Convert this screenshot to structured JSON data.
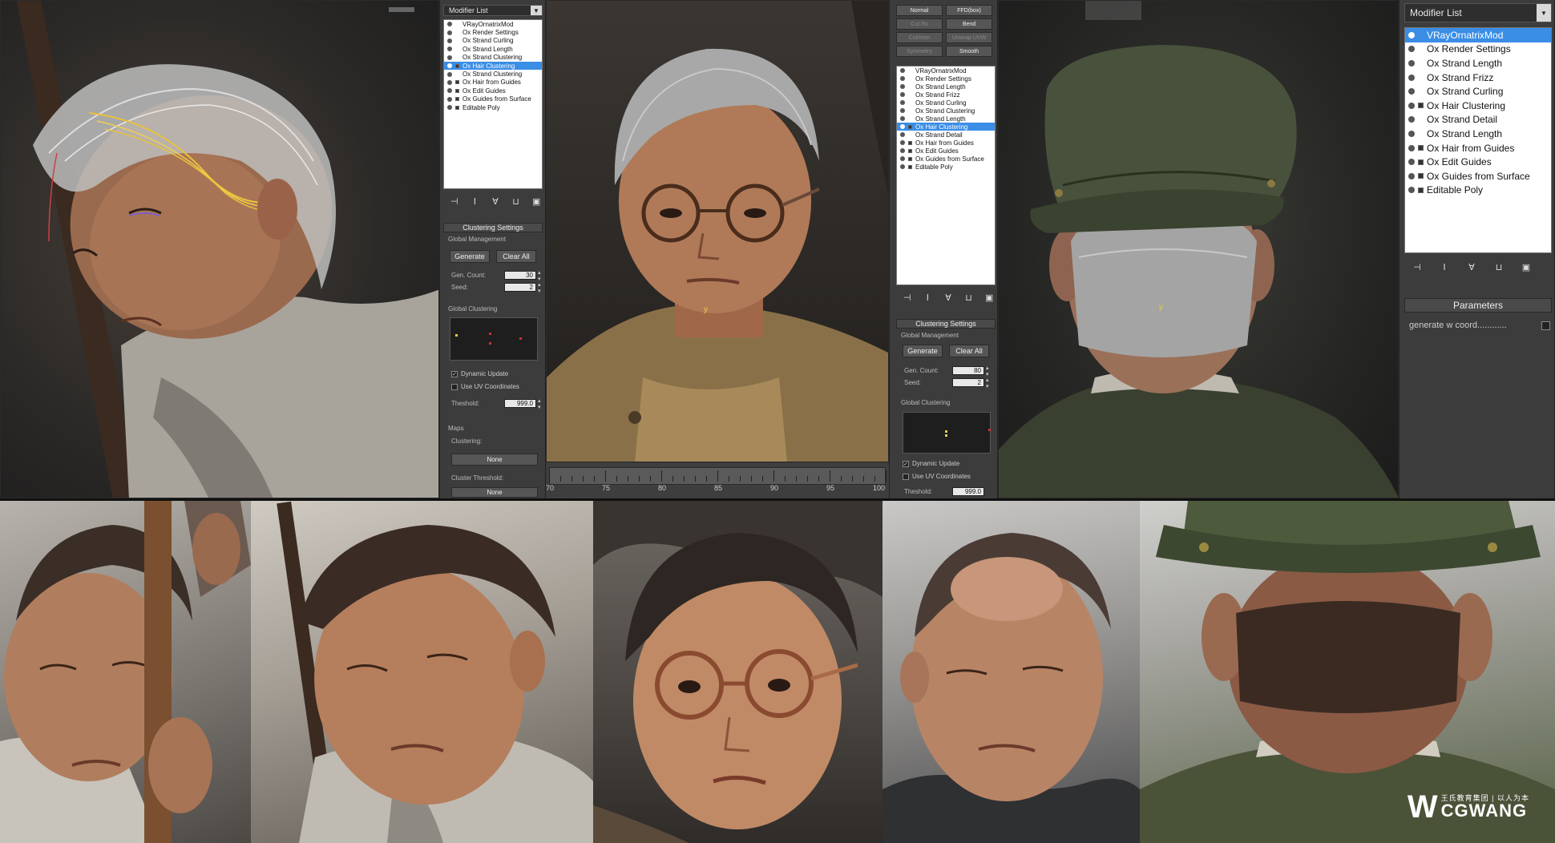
{
  "panel_left": {
    "header": "Modifier List",
    "stack": [
      {
        "label": "VRayOrnatrixMod",
        "selected": false
      },
      {
        "label": "Ox Render Settings",
        "selected": false
      },
      {
        "label": "Ox Strand Curling",
        "selected": false
      },
      {
        "label": "Ox Strand Length",
        "selected": false
      },
      {
        "label": "Ox Strand Clustering",
        "selected": false
      },
      {
        "label": "Ox Hair Clustering",
        "selected": true
      },
      {
        "label": "Ox Strand Clustering",
        "selected": false
      },
      {
        "label": "Ox Hair from Guides",
        "selected": false
      },
      {
        "label": "Ox Edit Guides",
        "selected": false
      },
      {
        "label": "Ox Guides from Surface",
        "selected": false
      },
      {
        "label": "Editable Poly",
        "selected": false
      }
    ],
    "rollout_title": "Clustering Settings",
    "global_management": "Global Management",
    "generate": "Generate",
    "clear_all": "Clear All",
    "gen_count_label": "Gen. Count:",
    "gen_count_value": "30",
    "seed_label": "Seed:",
    "seed_value": "2",
    "global_clustering": "Global Clustering",
    "dynamic_update": "Dynamic Update",
    "use_uv": "Use UV Coordinates",
    "threshold_label": "Theshold:",
    "threshold_value": "999.0",
    "maps": "Maps",
    "clustering_label": "Clustering:",
    "none1": "None",
    "cluster_threshold": "Cluster Threshold:",
    "none2": "None"
  },
  "panel_mid": {
    "top_buttons": [
      "Normal",
      "FFD(box)",
      "Cut Rx",
      "Bend",
      "Cut/mon",
      "Unwrap UVW",
      "Symmetry",
      "Smooth"
    ],
    "stack": [
      {
        "label": "VRayOrnatrixMod",
        "selected": false
      },
      {
        "label": "Ox Render Settings",
        "selected": false
      },
      {
        "label": "Ox Strand Length",
        "selected": false
      },
      {
        "label": "Ox Strand Frizz",
        "selected": false
      },
      {
        "label": "Ox Strand Curling",
        "selected": false
      },
      {
        "label": "Ox Strand Clustering",
        "selected": false
      },
      {
        "label": "Ox Strand Length",
        "selected": false
      },
      {
        "label": "Ox Hair Clustering",
        "selected": true
      },
      {
        "label": "Ox Strand Detail",
        "selected": false
      },
      {
        "label": "Ox Hair from Guides",
        "selected": false
      },
      {
        "label": "Ox Edit Guides",
        "selected": false
      },
      {
        "label": "Ox Guides from Surface",
        "selected": false
      },
      {
        "label": "Editable Poly",
        "selected": false
      }
    ],
    "rollout_title": "Clustering Settings",
    "global_management": "Global Management",
    "generate": "Generate",
    "clear_all": "Clear All",
    "gen_count_label": "Gen. Count:",
    "gen_count_value": "80",
    "seed_label": "Seed:",
    "seed_value": "2",
    "global_clustering": "Global Clustering",
    "dynamic_update": "Dynamic Update",
    "use_uv": "Use UV Coordinates",
    "threshold_label": "Theshold:",
    "threshold_value": "999.0"
  },
  "panel_right": {
    "header": "Modifier List",
    "stack": [
      {
        "label": "VRayOrnatrixMod",
        "selected": true
      },
      {
        "label": "Ox Render Settings",
        "selected": false
      },
      {
        "label": "Ox Strand Length",
        "selected": false
      },
      {
        "label": "Ox Strand Frizz",
        "selected": false
      },
      {
        "label": "Ox Strand Curling",
        "selected": false
      },
      {
        "label": "Ox Hair Clustering",
        "selected": false
      },
      {
        "label": "Ox Strand Detail",
        "selected": false
      },
      {
        "label": "Ox Strand Length",
        "selected": false
      },
      {
        "label": "Ox Hair from Guides",
        "selected": false
      },
      {
        "label": "Ox Edit Guides",
        "selected": false
      },
      {
        "label": "Ox Guides from Surface",
        "selected": false
      },
      {
        "label": "Editable Poly",
        "selected": false
      }
    ],
    "rollout_title": "Parameters",
    "generate_w": "generate w coord............"
  },
  "timeline": {
    "labels": [
      "70",
      "75",
      "80",
      "85",
      "90",
      "95",
      "100"
    ]
  },
  "watermark": {
    "sub": "王氏教育集团 | 以人为本",
    "main": "CGWANG"
  },
  "colors": {
    "selected": "#3a8ee6",
    "panel_bg": "#3c3c3c"
  }
}
